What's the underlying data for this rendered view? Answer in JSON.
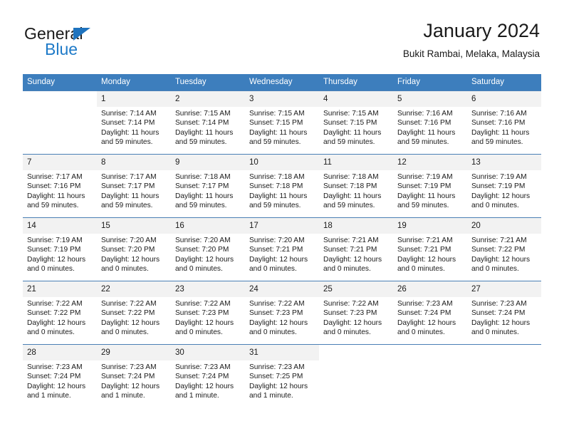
{
  "brand": {
    "word1": "General",
    "word2": "Blue",
    "triangle_color": "#1e73be",
    "blue_color": "#1e7ac8"
  },
  "header": {
    "title": "January 2024",
    "subtitle": "Bukit Rambai, Melaka, Malaysia"
  },
  "theme": {
    "header_row_bg": "#3d7ebd",
    "grid_line": "#4a7fb5",
    "daynum_bg": "#f2f2f2",
    "text": "#1a1a1a"
  },
  "weekdays": [
    "Sunday",
    "Monday",
    "Tuesday",
    "Wednesday",
    "Thursday",
    "Friday",
    "Saturday"
  ],
  "weeks": [
    [
      {
        "day": "",
        "sunrise": "",
        "sunset": "",
        "daylight": ""
      },
      {
        "day": "1",
        "sunrise": "Sunrise: 7:14 AM",
        "sunset": "Sunset: 7:14 PM",
        "daylight": "Daylight: 11 hours and 59 minutes."
      },
      {
        "day": "2",
        "sunrise": "Sunrise: 7:15 AM",
        "sunset": "Sunset: 7:14 PM",
        "daylight": "Daylight: 11 hours and 59 minutes."
      },
      {
        "day": "3",
        "sunrise": "Sunrise: 7:15 AM",
        "sunset": "Sunset: 7:15 PM",
        "daylight": "Daylight: 11 hours and 59 minutes."
      },
      {
        "day": "4",
        "sunrise": "Sunrise: 7:15 AM",
        "sunset": "Sunset: 7:15 PM",
        "daylight": "Daylight: 11 hours and 59 minutes."
      },
      {
        "day": "5",
        "sunrise": "Sunrise: 7:16 AM",
        "sunset": "Sunset: 7:16 PM",
        "daylight": "Daylight: 11 hours and 59 minutes."
      },
      {
        "day": "6",
        "sunrise": "Sunrise: 7:16 AM",
        "sunset": "Sunset: 7:16 PM",
        "daylight": "Daylight: 11 hours and 59 minutes."
      }
    ],
    [
      {
        "day": "7",
        "sunrise": "Sunrise: 7:17 AM",
        "sunset": "Sunset: 7:16 PM",
        "daylight": "Daylight: 11 hours and 59 minutes."
      },
      {
        "day": "8",
        "sunrise": "Sunrise: 7:17 AM",
        "sunset": "Sunset: 7:17 PM",
        "daylight": "Daylight: 11 hours and 59 minutes."
      },
      {
        "day": "9",
        "sunrise": "Sunrise: 7:18 AM",
        "sunset": "Sunset: 7:17 PM",
        "daylight": "Daylight: 11 hours and 59 minutes."
      },
      {
        "day": "10",
        "sunrise": "Sunrise: 7:18 AM",
        "sunset": "Sunset: 7:18 PM",
        "daylight": "Daylight: 11 hours and 59 minutes."
      },
      {
        "day": "11",
        "sunrise": "Sunrise: 7:18 AM",
        "sunset": "Sunset: 7:18 PM",
        "daylight": "Daylight: 11 hours and 59 minutes."
      },
      {
        "day": "12",
        "sunrise": "Sunrise: 7:19 AM",
        "sunset": "Sunset: 7:19 PM",
        "daylight": "Daylight: 11 hours and 59 minutes."
      },
      {
        "day": "13",
        "sunrise": "Sunrise: 7:19 AM",
        "sunset": "Sunset: 7:19 PM",
        "daylight": "Daylight: 12 hours and 0 minutes."
      }
    ],
    [
      {
        "day": "14",
        "sunrise": "Sunrise: 7:19 AM",
        "sunset": "Sunset: 7:19 PM",
        "daylight": "Daylight: 12 hours and 0 minutes."
      },
      {
        "day": "15",
        "sunrise": "Sunrise: 7:20 AM",
        "sunset": "Sunset: 7:20 PM",
        "daylight": "Daylight: 12 hours and 0 minutes."
      },
      {
        "day": "16",
        "sunrise": "Sunrise: 7:20 AM",
        "sunset": "Sunset: 7:20 PM",
        "daylight": "Daylight: 12 hours and 0 minutes."
      },
      {
        "day": "17",
        "sunrise": "Sunrise: 7:20 AM",
        "sunset": "Sunset: 7:21 PM",
        "daylight": "Daylight: 12 hours and 0 minutes."
      },
      {
        "day": "18",
        "sunrise": "Sunrise: 7:21 AM",
        "sunset": "Sunset: 7:21 PM",
        "daylight": "Daylight: 12 hours and 0 minutes."
      },
      {
        "day": "19",
        "sunrise": "Sunrise: 7:21 AM",
        "sunset": "Sunset: 7:21 PM",
        "daylight": "Daylight: 12 hours and 0 minutes."
      },
      {
        "day": "20",
        "sunrise": "Sunrise: 7:21 AM",
        "sunset": "Sunset: 7:22 PM",
        "daylight": "Daylight: 12 hours and 0 minutes."
      }
    ],
    [
      {
        "day": "21",
        "sunrise": "Sunrise: 7:22 AM",
        "sunset": "Sunset: 7:22 PM",
        "daylight": "Daylight: 12 hours and 0 minutes."
      },
      {
        "day": "22",
        "sunrise": "Sunrise: 7:22 AM",
        "sunset": "Sunset: 7:22 PM",
        "daylight": "Daylight: 12 hours and 0 minutes."
      },
      {
        "day": "23",
        "sunrise": "Sunrise: 7:22 AM",
        "sunset": "Sunset: 7:23 PM",
        "daylight": "Daylight: 12 hours and 0 minutes."
      },
      {
        "day": "24",
        "sunrise": "Sunrise: 7:22 AM",
        "sunset": "Sunset: 7:23 PM",
        "daylight": "Daylight: 12 hours and 0 minutes."
      },
      {
        "day": "25",
        "sunrise": "Sunrise: 7:22 AM",
        "sunset": "Sunset: 7:23 PM",
        "daylight": "Daylight: 12 hours and 0 minutes."
      },
      {
        "day": "26",
        "sunrise": "Sunrise: 7:23 AM",
        "sunset": "Sunset: 7:24 PM",
        "daylight": "Daylight: 12 hours and 0 minutes."
      },
      {
        "day": "27",
        "sunrise": "Sunrise: 7:23 AM",
        "sunset": "Sunset: 7:24 PM",
        "daylight": "Daylight: 12 hours and 0 minutes."
      }
    ],
    [
      {
        "day": "28",
        "sunrise": "Sunrise: 7:23 AM",
        "sunset": "Sunset: 7:24 PM",
        "daylight": "Daylight: 12 hours and 1 minute."
      },
      {
        "day": "29",
        "sunrise": "Sunrise: 7:23 AM",
        "sunset": "Sunset: 7:24 PM",
        "daylight": "Daylight: 12 hours and 1 minute."
      },
      {
        "day": "30",
        "sunrise": "Sunrise: 7:23 AM",
        "sunset": "Sunset: 7:24 PM",
        "daylight": "Daylight: 12 hours and 1 minute."
      },
      {
        "day": "31",
        "sunrise": "Sunrise: 7:23 AM",
        "sunset": "Sunset: 7:25 PM",
        "daylight": "Daylight: 12 hours and 1 minute."
      },
      {
        "day": "",
        "sunrise": "",
        "sunset": "",
        "daylight": ""
      },
      {
        "day": "",
        "sunrise": "",
        "sunset": "",
        "daylight": ""
      },
      {
        "day": "",
        "sunrise": "",
        "sunset": "",
        "daylight": ""
      }
    ]
  ]
}
